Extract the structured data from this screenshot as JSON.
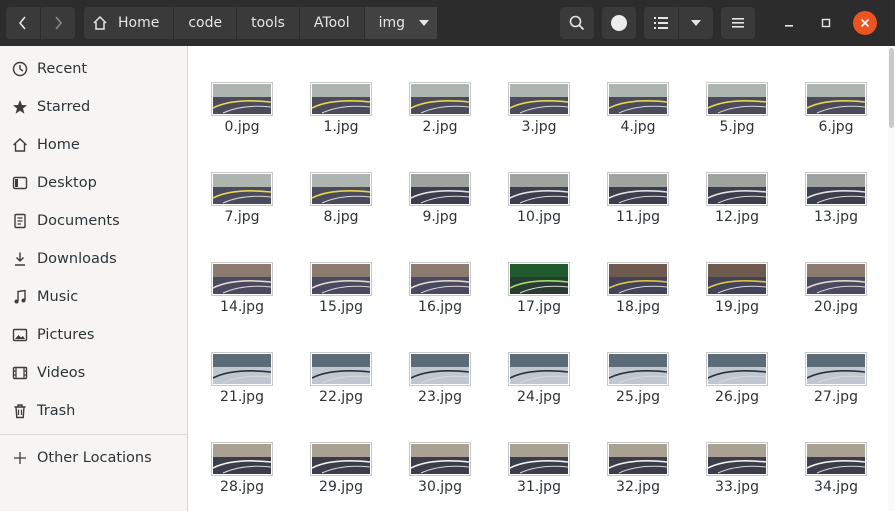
{
  "breadcrumbs": [
    "Home",
    "code",
    "tools",
    "ATool",
    "img"
  ],
  "sidebar": {
    "items": [
      {
        "label": "Recent",
        "icon": "clock-icon"
      },
      {
        "label": "Starred",
        "icon": "star-icon"
      },
      {
        "label": "Home",
        "icon": "home-icon"
      },
      {
        "label": "Desktop",
        "icon": "desktop-icon"
      },
      {
        "label": "Documents",
        "icon": "document-icon"
      },
      {
        "label": "Downloads",
        "icon": "download-icon"
      },
      {
        "label": "Music",
        "icon": "music-icon"
      },
      {
        "label": "Pictures",
        "icon": "picture-icon"
      },
      {
        "label": "Videos",
        "icon": "video-icon"
      },
      {
        "label": "Trash",
        "icon": "trash-icon"
      }
    ],
    "other_locations": "Other Locations"
  },
  "files": [
    {
      "name": "0.jpg",
      "scene": "track"
    },
    {
      "name": "1.jpg",
      "scene": "track"
    },
    {
      "name": "2.jpg",
      "scene": "track"
    },
    {
      "name": "3.jpg",
      "scene": "track"
    },
    {
      "name": "4.jpg",
      "scene": "track"
    },
    {
      "name": "5.jpg",
      "scene": "track"
    },
    {
      "name": "6.jpg",
      "scene": "track"
    },
    {
      "name": "7.jpg",
      "scene": "track"
    },
    {
      "name": "8.jpg",
      "scene": "track"
    },
    {
      "name": "9.jpg",
      "scene": "track-dark"
    },
    {
      "name": "10.jpg",
      "scene": "track-dark"
    },
    {
      "name": "11.jpg",
      "scene": "track-dark"
    },
    {
      "name": "12.jpg",
      "scene": "track-dark"
    },
    {
      "name": "13.jpg",
      "scene": "track-dark"
    },
    {
      "name": "14.jpg",
      "scene": "room"
    },
    {
      "name": "15.jpg",
      "scene": "room"
    },
    {
      "name": "16.jpg",
      "scene": "room"
    },
    {
      "name": "17.jpg",
      "scene": "green"
    },
    {
      "name": "18.jpg",
      "scene": "room-yellow"
    },
    {
      "name": "19.jpg",
      "scene": "room-yellow"
    },
    {
      "name": "20.jpg",
      "scene": "room"
    },
    {
      "name": "21.jpg",
      "scene": "floor"
    },
    {
      "name": "22.jpg",
      "scene": "floor"
    },
    {
      "name": "23.jpg",
      "scene": "floor"
    },
    {
      "name": "24.jpg",
      "scene": "floor"
    },
    {
      "name": "25.jpg",
      "scene": "floor"
    },
    {
      "name": "26.jpg",
      "scene": "floor"
    },
    {
      "name": "27.jpg",
      "scene": "floor"
    },
    {
      "name": "28.jpg",
      "scene": "lane"
    },
    {
      "name": "29.jpg",
      "scene": "lane"
    },
    {
      "name": "30.jpg",
      "scene": "lane"
    },
    {
      "name": "31.jpg",
      "scene": "lane"
    },
    {
      "name": "32.jpg",
      "scene": "lane"
    },
    {
      "name": "33.jpg",
      "scene": "lane"
    },
    {
      "name": "34.jpg",
      "scene": "lane"
    }
  ]
}
